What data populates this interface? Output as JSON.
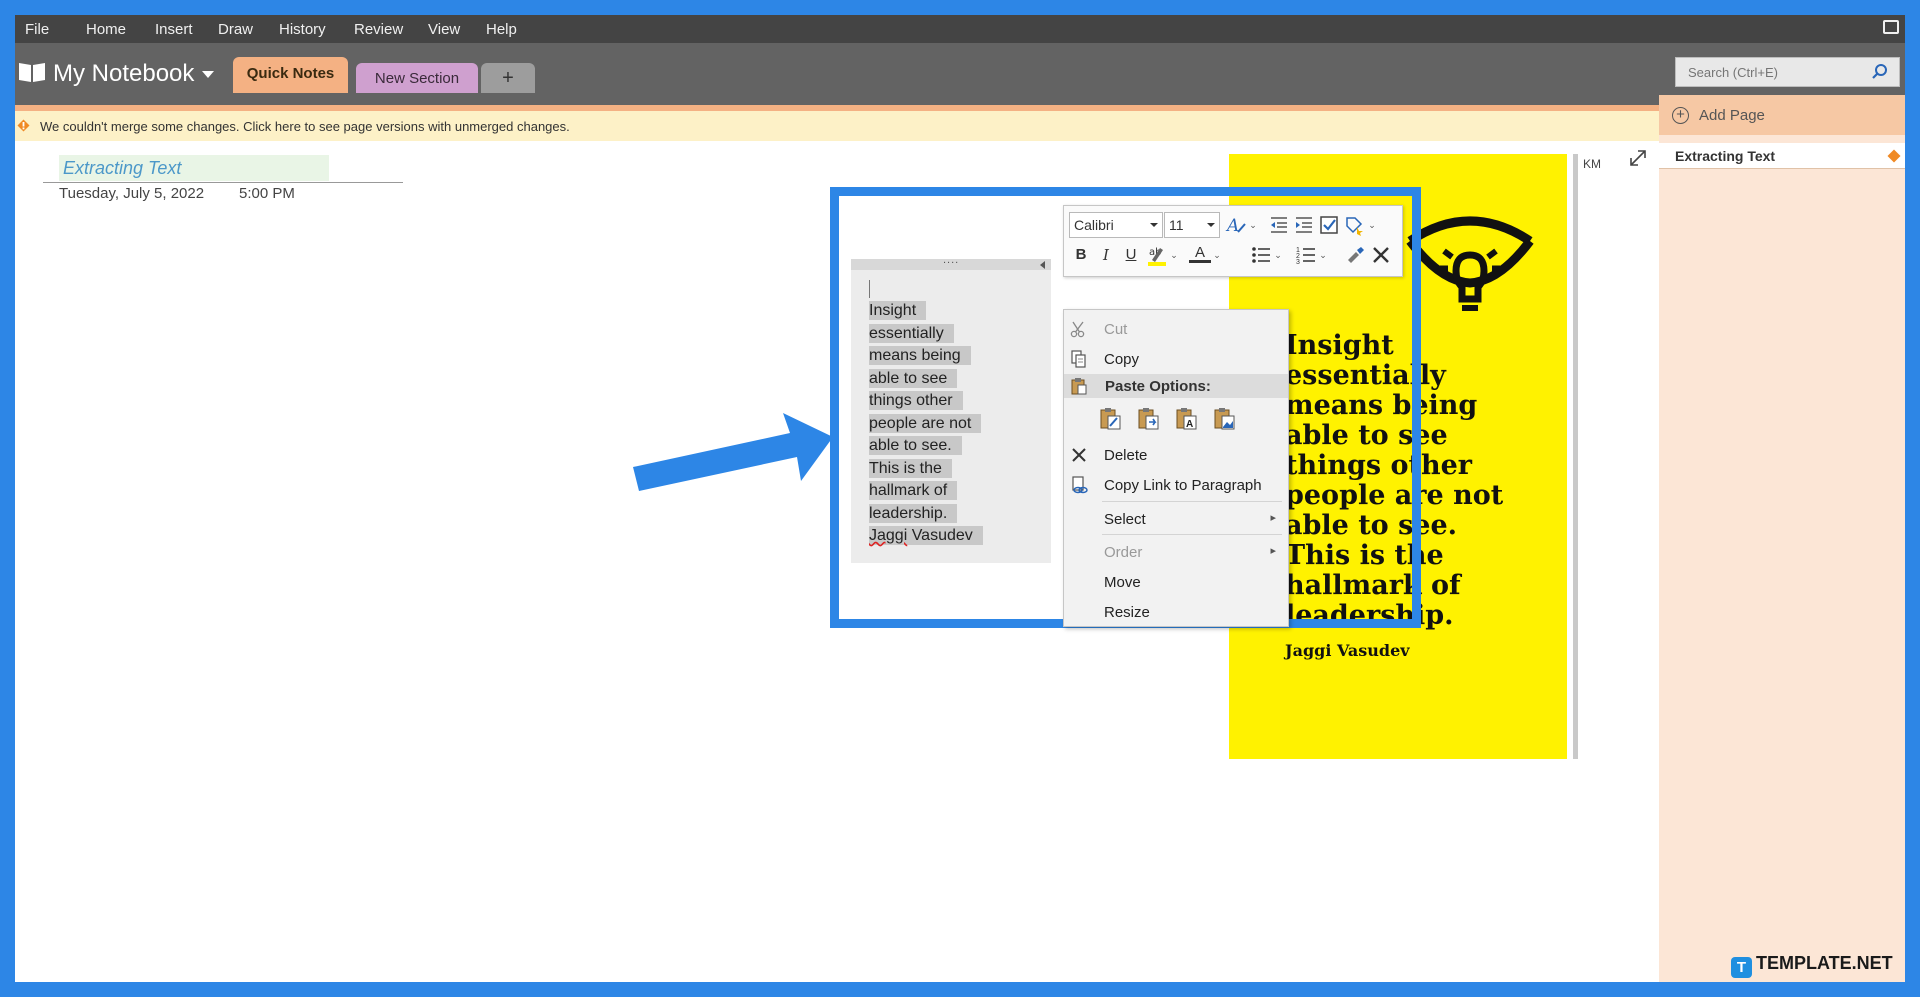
{
  "menu": [
    "File",
    "Home",
    "Insert",
    "Draw",
    "History",
    "Review",
    "View",
    "Help"
  ],
  "notebook": {
    "title": "My Notebook",
    "tabs": {
      "quick_notes": "Quick Notes",
      "new_section": "New Section",
      "add": "+"
    }
  },
  "search": {
    "placeholder": "Search (Ctrl+E)"
  },
  "notification": "We couldn't merge some changes. Click here to see page versions with unmerged changes.",
  "page": {
    "title": "Extracting Text",
    "date": "Tuesday, July 5, 2022",
    "time": "5:00 PM"
  },
  "note_lines": [
    "Insight",
    "essentially",
    "means being",
    "able to see",
    "things other",
    "people are not",
    "able to see.",
    "This is the",
    "hallmark of",
    "leadership.",
    "Jaggi Vasudev"
  ],
  "image": {
    "quote_lines": [
      "Insight",
      "essentially",
      "means being",
      "able to see",
      "things other",
      "people are not",
      "able to see.",
      "This is the",
      "hallmark of",
      "leadership."
    ],
    "author": "Jaggi Vasudev"
  },
  "author_initials": "KM",
  "mini_toolbar": {
    "font": "Calibri",
    "size": "11",
    "bold": "B",
    "italic": "I",
    "underline": "U",
    "font_color": "A"
  },
  "context_menu": {
    "cut": "Cut",
    "copy": "Copy",
    "paste_options": "Paste Options:",
    "delete": "Delete",
    "copy_link": "Copy Link to Paragraph",
    "select": "Select",
    "order": "Order",
    "move": "Move",
    "resize": "Resize"
  },
  "pages_pane": {
    "add_page": "Add Page",
    "pages": [
      "Extracting Text"
    ]
  },
  "watermark": {
    "icon": "T",
    "text": "TEMPLATE.NET"
  },
  "colors": {
    "accent": "#2d86e6",
    "section_quick": "#f4b183",
    "section_new": "#cfa0cf",
    "image_bg": "#fff200"
  }
}
